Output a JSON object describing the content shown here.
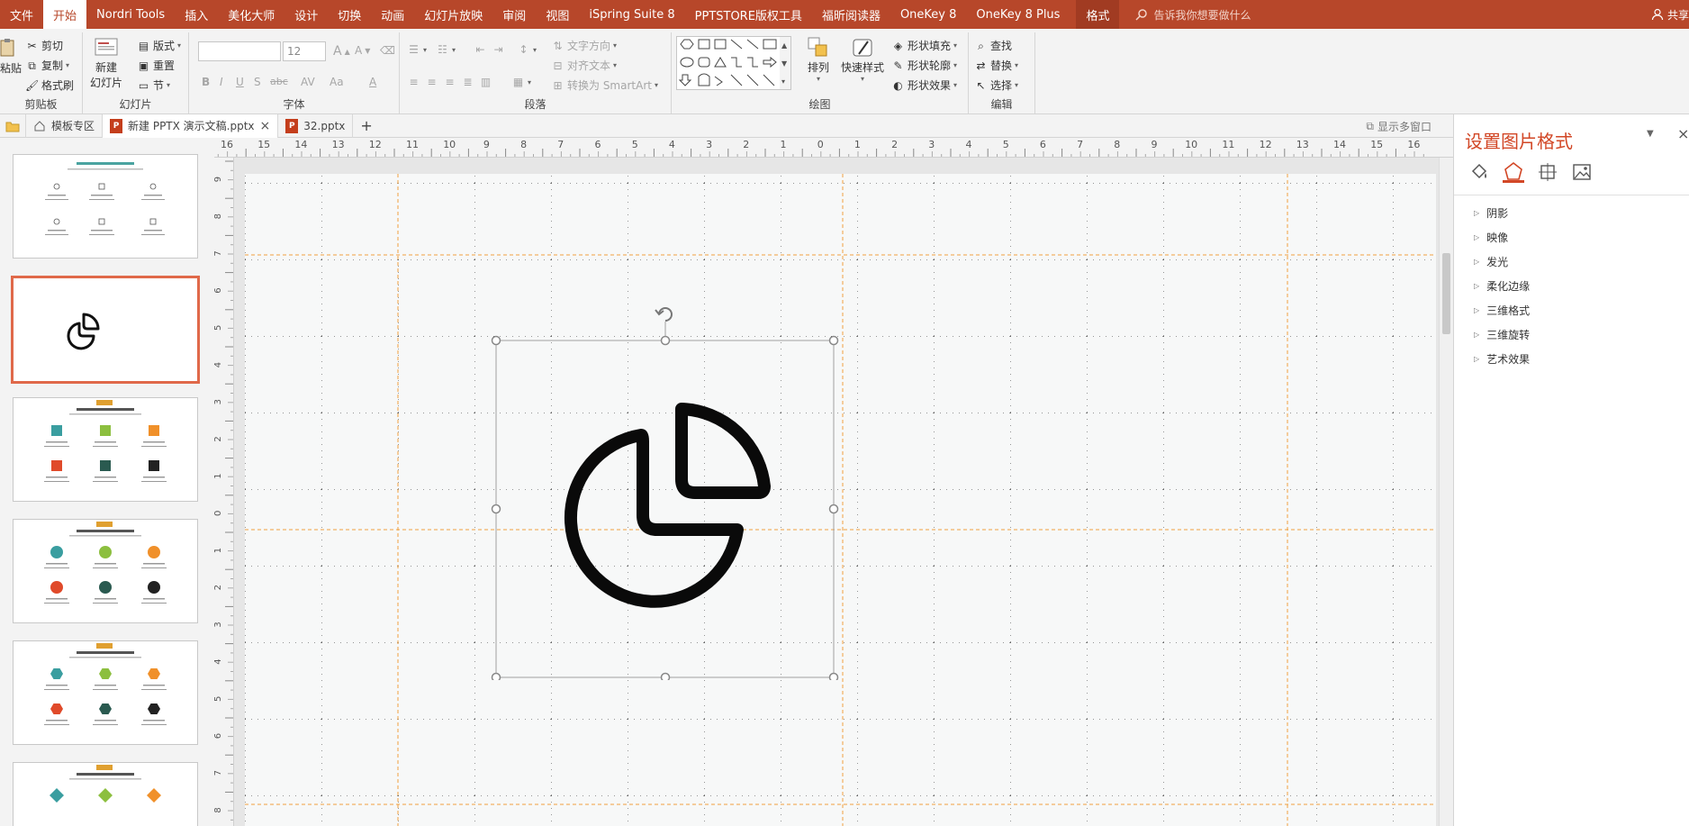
{
  "tabs": [
    {
      "label": "文件"
    },
    {
      "label": "开始"
    },
    {
      "label": "Nordri Tools"
    },
    {
      "label": "插入"
    },
    {
      "label": "美化大师"
    },
    {
      "label": "设计"
    },
    {
      "label": "切换"
    },
    {
      "label": "动画"
    },
    {
      "label": "幻灯片放映"
    },
    {
      "label": "审阅"
    },
    {
      "label": "视图"
    },
    {
      "label": "iSpring Suite 8"
    },
    {
      "label": "PPTSTORE版权工具"
    },
    {
      "label": "福昕阅读器"
    },
    {
      "label": "OneKey 8"
    },
    {
      "label": "OneKey 8 Plus"
    },
    {
      "label": "格式"
    }
  ],
  "tellme": {
    "placeholder": "告诉我你想要做什么"
  },
  "share": {
    "label": "共享"
  },
  "ribbon": {
    "clipboard": {
      "paste": "粘贴",
      "cut": "剪切",
      "copy": "复制",
      "format_painter": "格式刷",
      "name": "剪贴板"
    },
    "slides": {
      "new_slide_l1": "新建",
      "new_slide_l2": "幻灯片",
      "layout": "版式",
      "reset": "重置",
      "section": "节",
      "name": "幻灯片"
    },
    "font": {
      "font_size": "12",
      "name": "字体",
      "b": "B",
      "i": "I",
      "u": "U",
      "s": "S",
      "abc": "abc",
      "av": "AV",
      "aa": "Aa",
      "a": "A",
      "grow": "A",
      "shrink": "A"
    },
    "paragraph": {
      "text_direction": "文字方向",
      "align_text": "对齐文本",
      "smartart": "转换为 SmartArt",
      "name": "段落"
    },
    "drawing": {
      "arrange": "排列",
      "quick_styles": "快速样式",
      "shape_fill": "形状填充",
      "shape_outline": "形状轮廓",
      "shape_effects": "形状效果",
      "name": "绘图"
    },
    "editing": {
      "find": "查找",
      "replace": "替换",
      "select": "选择",
      "name": "编辑"
    }
  },
  "doctabs": [
    {
      "label": "模板专区"
    },
    {
      "label": "新建 PPTX 演示文稿.pptx"
    },
    {
      "label": "32.pptx"
    }
  ],
  "doctabs_extra": {
    "plus": "+",
    "multiwindow": "显示多窗口",
    "close": "×",
    "ppt_p": "P"
  },
  "ruler": {
    "h_ticks": [
      "16",
      "15",
      "14",
      "13",
      "12",
      "11",
      "10",
      "9",
      "8",
      "7",
      "6",
      "5",
      "4",
      "3",
      "2",
      "1",
      "0",
      "1",
      "2",
      "3",
      "4",
      "5",
      "6",
      "7",
      "8",
      "9",
      "10",
      "11",
      "12",
      "13",
      "14",
      "15",
      "16"
    ],
    "v_ticks": [
      "9",
      "8",
      "7",
      "6",
      "5",
      "4",
      "3",
      "2",
      "1",
      "0",
      "1",
      "2",
      "3",
      "4",
      "5",
      "6",
      "7",
      "8"
    ]
  },
  "pane": {
    "title": "设置图片格式",
    "icons": [
      "fill-line-icon",
      "effects-icon",
      "size-properties-icon",
      "picture-icon"
    ],
    "items": [
      {
        "label": "阴影"
      },
      {
        "label": "映像"
      },
      {
        "label": "发光"
      },
      {
        "label": "柔化边缘"
      },
      {
        "label": "三维格式"
      },
      {
        "label": "三维旋转"
      },
      {
        "label": "艺术效果"
      }
    ]
  },
  "colors": {
    "accent": "#b7472a",
    "selection": "#e0694a",
    "guide": "#f0a040"
  }
}
